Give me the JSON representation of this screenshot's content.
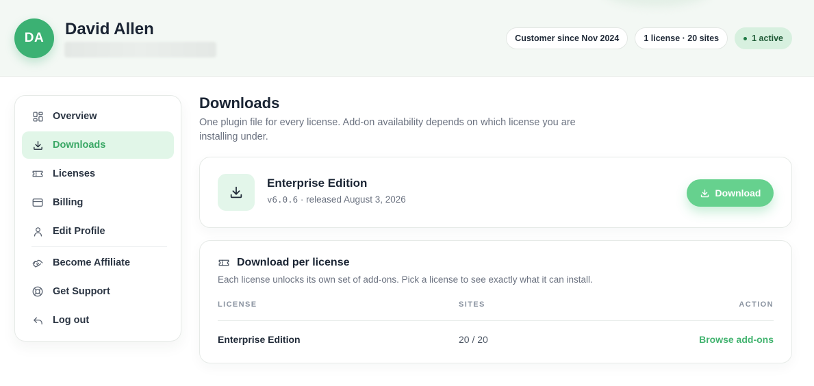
{
  "user": {
    "initials": "DA",
    "name": "David Allen"
  },
  "badges": {
    "customer_since": "Customer since Nov 2024",
    "licenses": "1 license · 20 sites",
    "active": "1 active"
  },
  "sidebar": {
    "items": [
      {
        "label": "Overview",
        "icon": "grid-icon"
      },
      {
        "label": "Downloads",
        "icon": "download-icon",
        "selected": true
      },
      {
        "label": "Licenses",
        "icon": "ticket-icon"
      },
      {
        "label": "Billing",
        "icon": "credit-card-icon"
      },
      {
        "label": "Edit Profile",
        "icon": "user-icon"
      },
      {
        "label": "Become Affiliate",
        "icon": "handshake-icon"
      },
      {
        "label": "Get Support",
        "icon": "lifebuoy-icon"
      },
      {
        "label": "Log out",
        "icon": "logout-icon"
      }
    ]
  },
  "main": {
    "title": "Downloads",
    "subtitle": "One plugin file for every license. Add-on availability depends on which license you are installing under."
  },
  "product": {
    "name": "Enterprise Edition",
    "version": "v6.0.6",
    "released": "· released August 3, 2026",
    "download_label": "Download"
  },
  "per_license": {
    "title": "Download per license",
    "subtitle": "Each license unlocks its own set of add-ons. Pick a license to see exactly what it can install.",
    "columns": [
      "LICENSE",
      "SITES",
      "ACTION"
    ],
    "rows": [
      {
        "license": "Enterprise Edition",
        "sites": "20 / 20",
        "action": "Browse add-ons"
      }
    ]
  },
  "colors": {
    "accent": "#3bb173",
    "accent_light": "#e1f6e8",
    "download_button": "#66d18e",
    "link": "#42b36f"
  }
}
